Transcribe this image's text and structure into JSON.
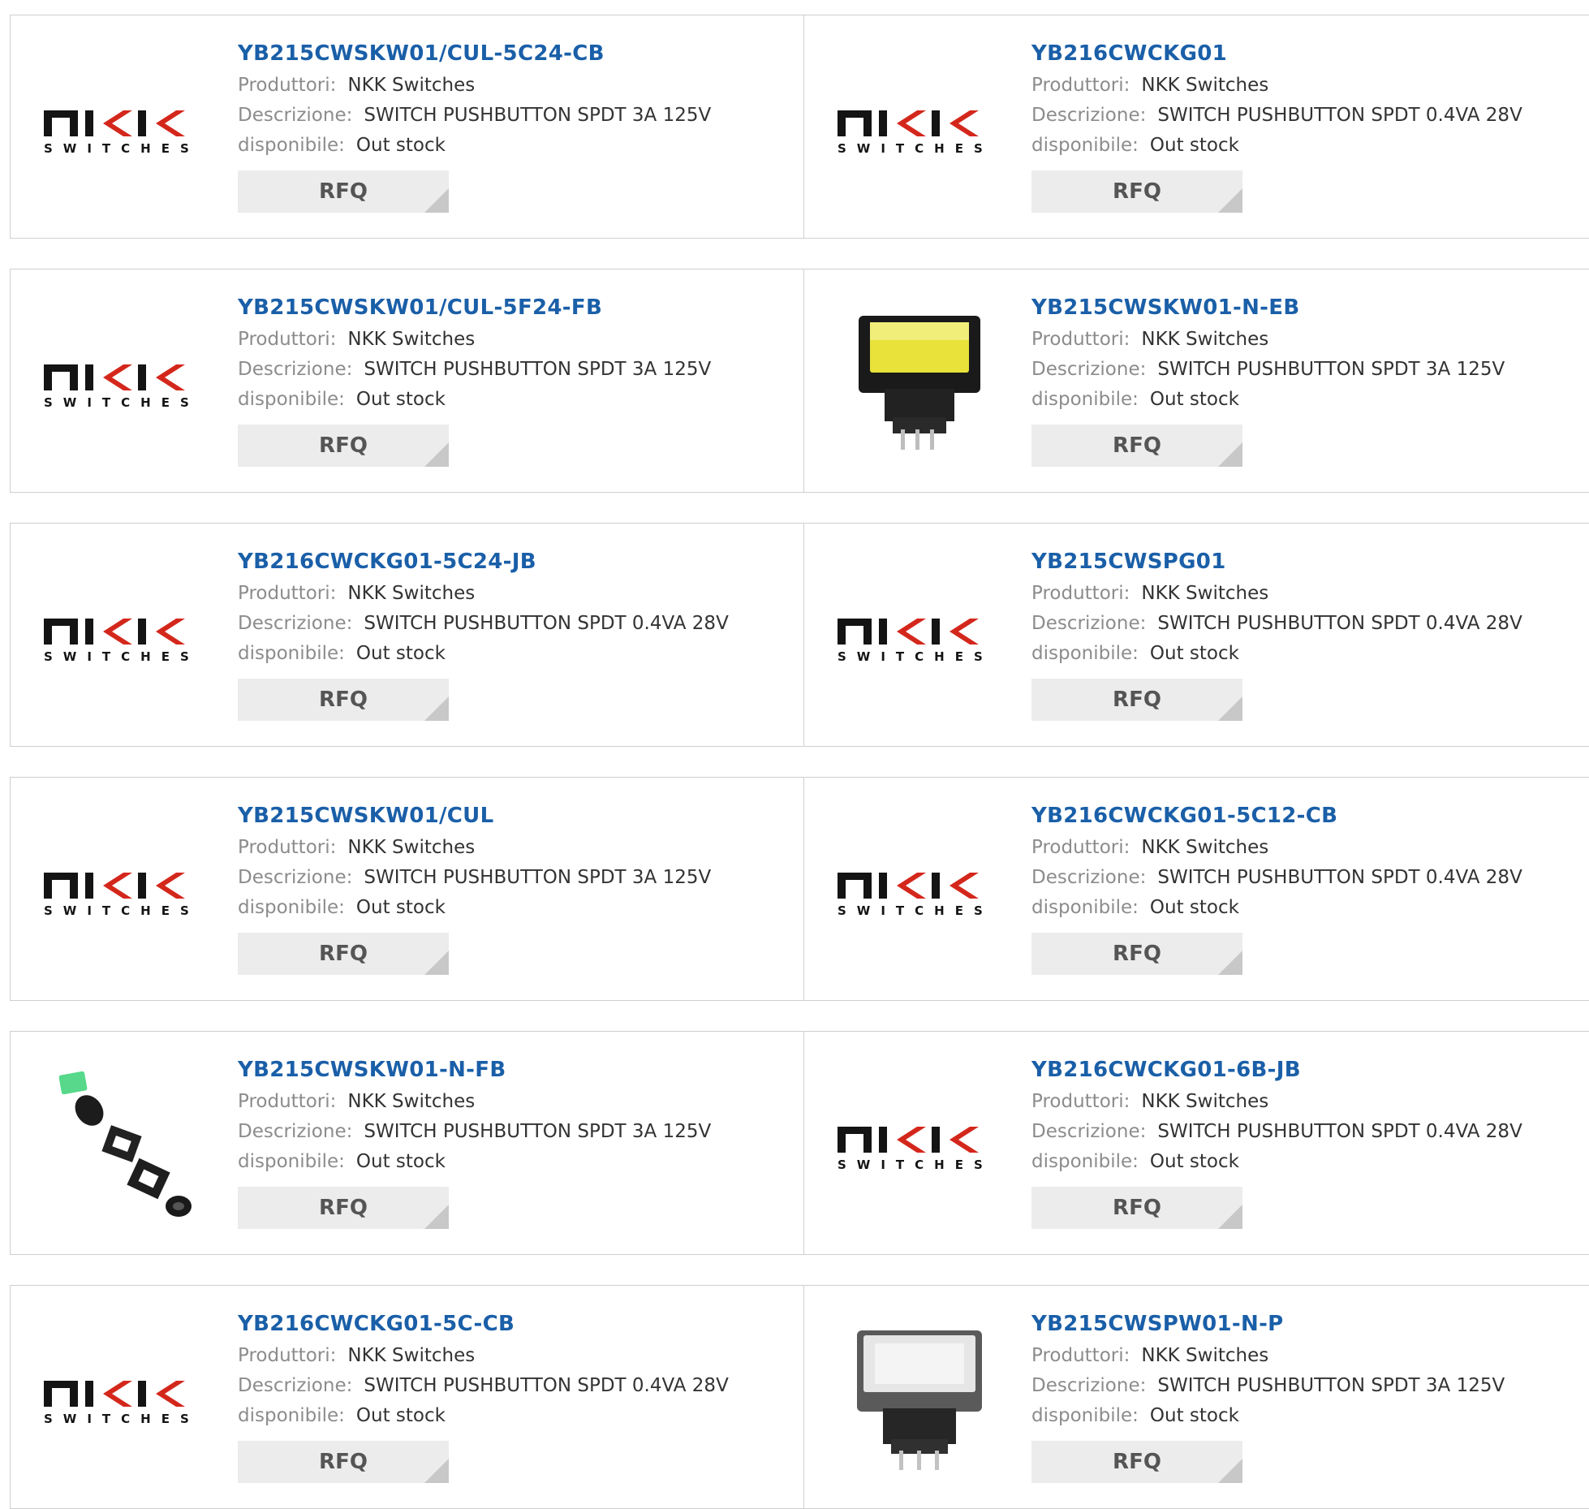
{
  "labels": {
    "producer": "Produttori:",
    "description": "Descrizione:",
    "available": "disponibile:",
    "rfq": "RFQ"
  },
  "logo": {
    "brand_text": "SWITCHES"
  },
  "products": [
    {
      "part": "YB215CWSKW01/CUL-5C24-CB",
      "producer": "NKK Switches",
      "description": "SWITCH PUSHBUTTON SPDT 3A 125V",
      "available": "Out stock",
      "image": "nkk-logo"
    },
    {
      "part": "YB216CWCKG01",
      "producer": "NKK Switches",
      "description": "SWITCH PUSHBUTTON SPDT 0.4VA 28V",
      "available": "Out stock",
      "image": "nkk-logo"
    },
    {
      "part": "YB215CWSKW01/CUL-5F24-FB",
      "producer": "NKK Switches",
      "description": "SWITCH PUSHBUTTON SPDT 3A 125V",
      "available": "Out stock",
      "image": "nkk-logo"
    },
    {
      "part": "YB215CWSKW01-N-EB",
      "producer": "NKK Switches",
      "description": "SWITCH PUSHBUTTON SPDT 3A 125V",
      "available": "Out stock",
      "image": "yellow-switch-photo"
    },
    {
      "part": "YB216CWCKG01-5C24-JB",
      "producer": "NKK Switches",
      "description": "SWITCH PUSHBUTTON SPDT 0.4VA 28V",
      "available": "Out stock",
      "image": "nkk-logo"
    },
    {
      "part": "YB215CWSPG01",
      "producer": "NKK Switches",
      "description": "SWITCH PUSHBUTTON SPDT 0.4VA 28V",
      "available": "Out stock",
      "image": "nkk-logo"
    },
    {
      "part": "YB215CWSKW01/CUL",
      "producer": "NKK Switches",
      "description": "SWITCH PUSHBUTTON SPDT 3A 125V",
      "available": "Out stock",
      "image": "nkk-logo"
    },
    {
      "part": "YB216CWCKG01-5C12-CB",
      "producer": "NKK Switches",
      "description": "SWITCH PUSHBUTTON SPDT 0.4VA 28V",
      "available": "Out stock",
      "image": "nkk-logo"
    },
    {
      "part": "YB215CWSKW01-N-FB",
      "producer": "NKK Switches",
      "description": "SWITCH PUSHBUTTON SPDT 3A 125V",
      "available": "Out stock",
      "image": "exploded-switch-photo"
    },
    {
      "part": "YB216CWCKG01-6B-JB",
      "producer": "NKK Switches",
      "description": "SWITCH PUSHBUTTON SPDT 0.4VA 28V",
      "available": "Out stock",
      "image": "nkk-logo"
    },
    {
      "part": "YB216CWCKG01-5C-CB",
      "producer": "NKK Switches",
      "description": "SWITCH PUSHBUTTON SPDT 0.4VA 28V",
      "available": "Out stock",
      "image": "nkk-logo"
    },
    {
      "part": "YB215CWSPW01-N-P",
      "producer": "NKK Switches",
      "description": "SWITCH PUSHBUTTON SPDT 3A 125V",
      "available": "Out stock",
      "image": "white-switch-photo"
    }
  ]
}
